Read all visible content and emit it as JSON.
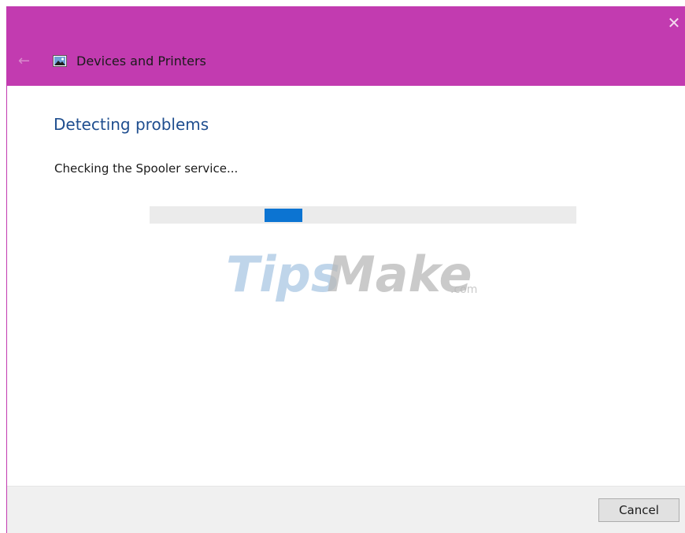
{
  "window": {
    "title": "Devices and Printers",
    "accent_color": "#c23bb0",
    "close_icon": "close-icon",
    "back_icon": "back-arrow-icon",
    "app_icon": "devices-printers-icon"
  },
  "main": {
    "heading": "Detecting problems",
    "status": "Checking the Spooler service...",
    "progress": {
      "type": "indeterminate",
      "chunk_color": "#0c74d2"
    }
  },
  "watermark": {
    "text_part1": "Tips",
    "text_part2": "Make",
    "suffix": ".com"
  },
  "footer": {
    "cancel_label": "Cancel"
  }
}
